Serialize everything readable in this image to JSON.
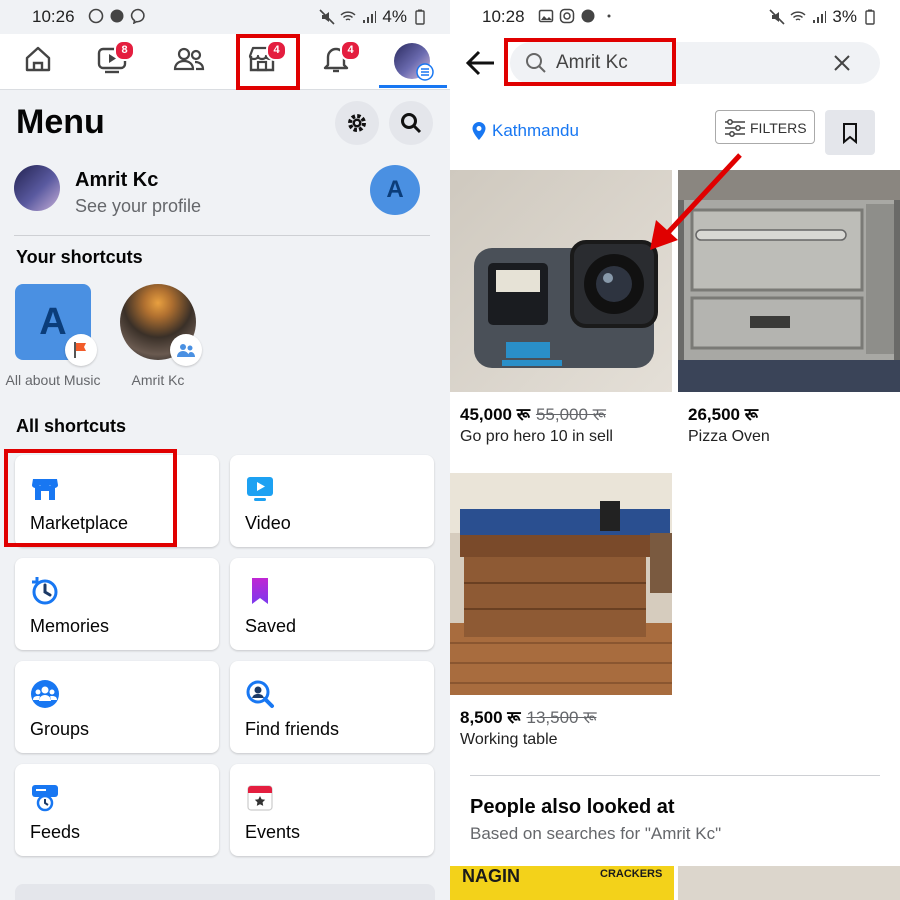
{
  "left": {
    "status": {
      "time": "10:26",
      "battery": "4%"
    },
    "nav": {
      "watch_badge": "8",
      "marketplace_badge": "4",
      "notifications_badge": "4"
    },
    "menu_title": "Menu",
    "profile": {
      "name": "Amrit Kc",
      "subtitle": "See your profile",
      "avatar_letter": "A"
    },
    "your_shortcuts_title": "Your shortcuts",
    "shortcuts": [
      {
        "label": "All about Music",
        "letter": "A"
      },
      {
        "label": "Amrit Kc"
      }
    ],
    "all_shortcuts_title": "All shortcuts",
    "cards": [
      {
        "label": "Marketplace",
        "icon": "marketplace-icon",
        "color": "#1877f2"
      },
      {
        "label": "Video",
        "icon": "video-icon",
        "color": "#1da1f2"
      },
      {
        "label": "Memories",
        "icon": "memories-icon",
        "color": "#1877f2"
      },
      {
        "label": "Saved",
        "icon": "saved-icon",
        "color": "#a855f7"
      },
      {
        "label": "Groups",
        "icon": "groups-icon",
        "color": "#1877f2"
      },
      {
        "label": "Find friends",
        "icon": "find-friends-icon",
        "color": "#1877f2"
      },
      {
        "label": "Feeds",
        "icon": "feeds-icon",
        "color": "#1877f2"
      },
      {
        "label": "Events",
        "icon": "events-icon",
        "color": "#e41e3f"
      }
    ]
  },
  "right": {
    "status": {
      "time": "10:28",
      "battery": "3%"
    },
    "search": {
      "value": "Amrit Kc"
    },
    "location": "Kathmandu",
    "filters_label": "FILTERS",
    "products": [
      {
        "price": "45,000 रू",
        "old_price": "55,000 रू",
        "title": "Go pro hero 10 in sell"
      },
      {
        "price": "26,500 रू",
        "old_price": "",
        "title": "Pizza Oven"
      },
      {
        "price": "8,500 रू",
        "old_price": "13,500 रू",
        "title": "Working table"
      }
    ],
    "people_also_title": "People also looked at",
    "people_also_sub": "Based on searches for \"Amrit Kc\"",
    "banner_words": {
      "left": "NAGIN",
      "right": "CRACKERS"
    }
  },
  "colors": {
    "accent": "#1877f2",
    "highlight": "#e00000",
    "badge": "#e41e3f"
  }
}
